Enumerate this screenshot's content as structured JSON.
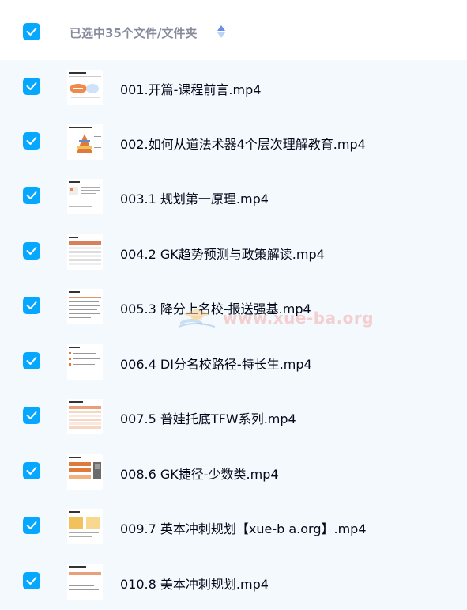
{
  "header": {
    "selection_label": "已选中35个文件/文件夹",
    "select_all_checked": true
  },
  "colors": {
    "accent": "#06a7ff",
    "text": "#03081a",
    "header_text": "#878c9c",
    "background": "#f4f9fd"
  },
  "files": [
    {
      "name": "001.开篇-课程前言.mp4",
      "checked": true,
      "thumb": "intro-slide"
    },
    {
      "name": "002.如何从道法术器4个层次理解教育.mp4",
      "checked": true,
      "thumb": "pyramid-slide"
    },
    {
      "name": "003.1 规划第一原理.mp4",
      "checked": true,
      "thumb": "text-slide"
    },
    {
      "name": "004.2 GK趋势预测与政策解读.mp4",
      "checked": true,
      "thumb": "table-slide"
    },
    {
      "name": "005.3 降分上名校-报送强基.mp4",
      "checked": true,
      "thumb": "text-slide"
    },
    {
      "name": "006.4 DI分名校路径-特长生.mp4",
      "checked": true,
      "thumb": "text-slide"
    },
    {
      "name": "007.5 普娃托底TFW系列.mp4",
      "checked": true,
      "thumb": "table-slide"
    },
    {
      "name": "008.6 GK捷径-少数类.mp4",
      "checked": true,
      "thumb": "photo-slide"
    },
    {
      "name": "009.7 英本冲刺规划【xue-b a.org】.mp4",
      "checked": true,
      "thumb": "box-slide"
    },
    {
      "name": "010.8 美本冲刺规划.mp4",
      "checked": true,
      "thumb": "text-slide"
    }
  ],
  "watermark": {
    "text": "www.xue-ba.org",
    "logo": "graduation-cap-book-logo"
  }
}
